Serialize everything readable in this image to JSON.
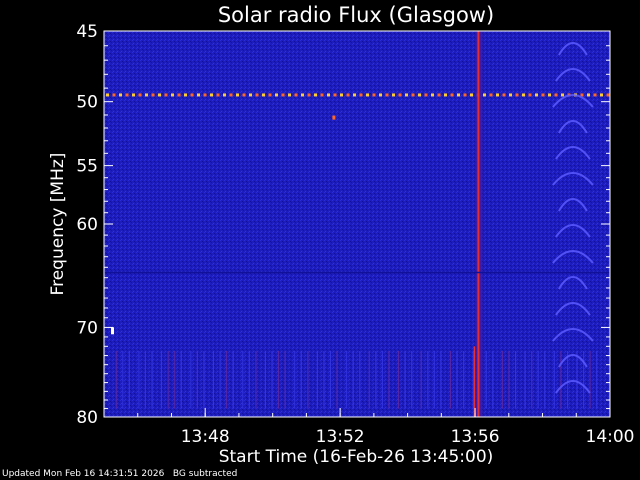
{
  "colors": {
    "background": "#000000",
    "plot_base": "#1a1ab8",
    "axis": "#ffffff",
    "text": "#ffffff",
    "burst": "#ff3322"
  },
  "footer": {
    "updated": "Updated Mon Feb 16 14:31:51 2026",
    "bg_note": "BG subtracted"
  },
  "chart_data": {
    "type": "heatmap",
    "title": "Solar radio Flux (Glasgow)",
    "xlabel": "Start Time (16-Feb-26 13:45:00)",
    "ylabel": "Frequency [MHz]",
    "x_range_minutes": [
      45,
      60
    ],
    "ylim": [
      45,
      80
    ],
    "y_scale": "log",
    "y_inverted": true,
    "x_ticks": [
      {
        "minute": 48,
        "label": "13:48"
      },
      {
        "minute": 52,
        "label": "13:52"
      },
      {
        "minute": 56,
        "label": "13:56"
      },
      {
        "minute": 60,
        "label": "14:00"
      }
    ],
    "y_ticks": [
      {
        "value": 45,
        "label": "45"
      },
      {
        "value": 50,
        "label": "50"
      },
      {
        "value": 55,
        "label": "55"
      },
      {
        "value": 60,
        "label": "60"
      },
      {
        "value": 70,
        "label": "70"
      },
      {
        "value": 80,
        "label": "80"
      }
    ],
    "features": [
      {
        "kind": "interference-line",
        "freq_mhz": 49.5
      },
      {
        "kind": "broadband-burst",
        "minute": 56.1
      },
      {
        "kind": "arcs",
        "minute_start": 58.2,
        "minute_end": 59.6
      }
    ],
    "grid": false
  }
}
